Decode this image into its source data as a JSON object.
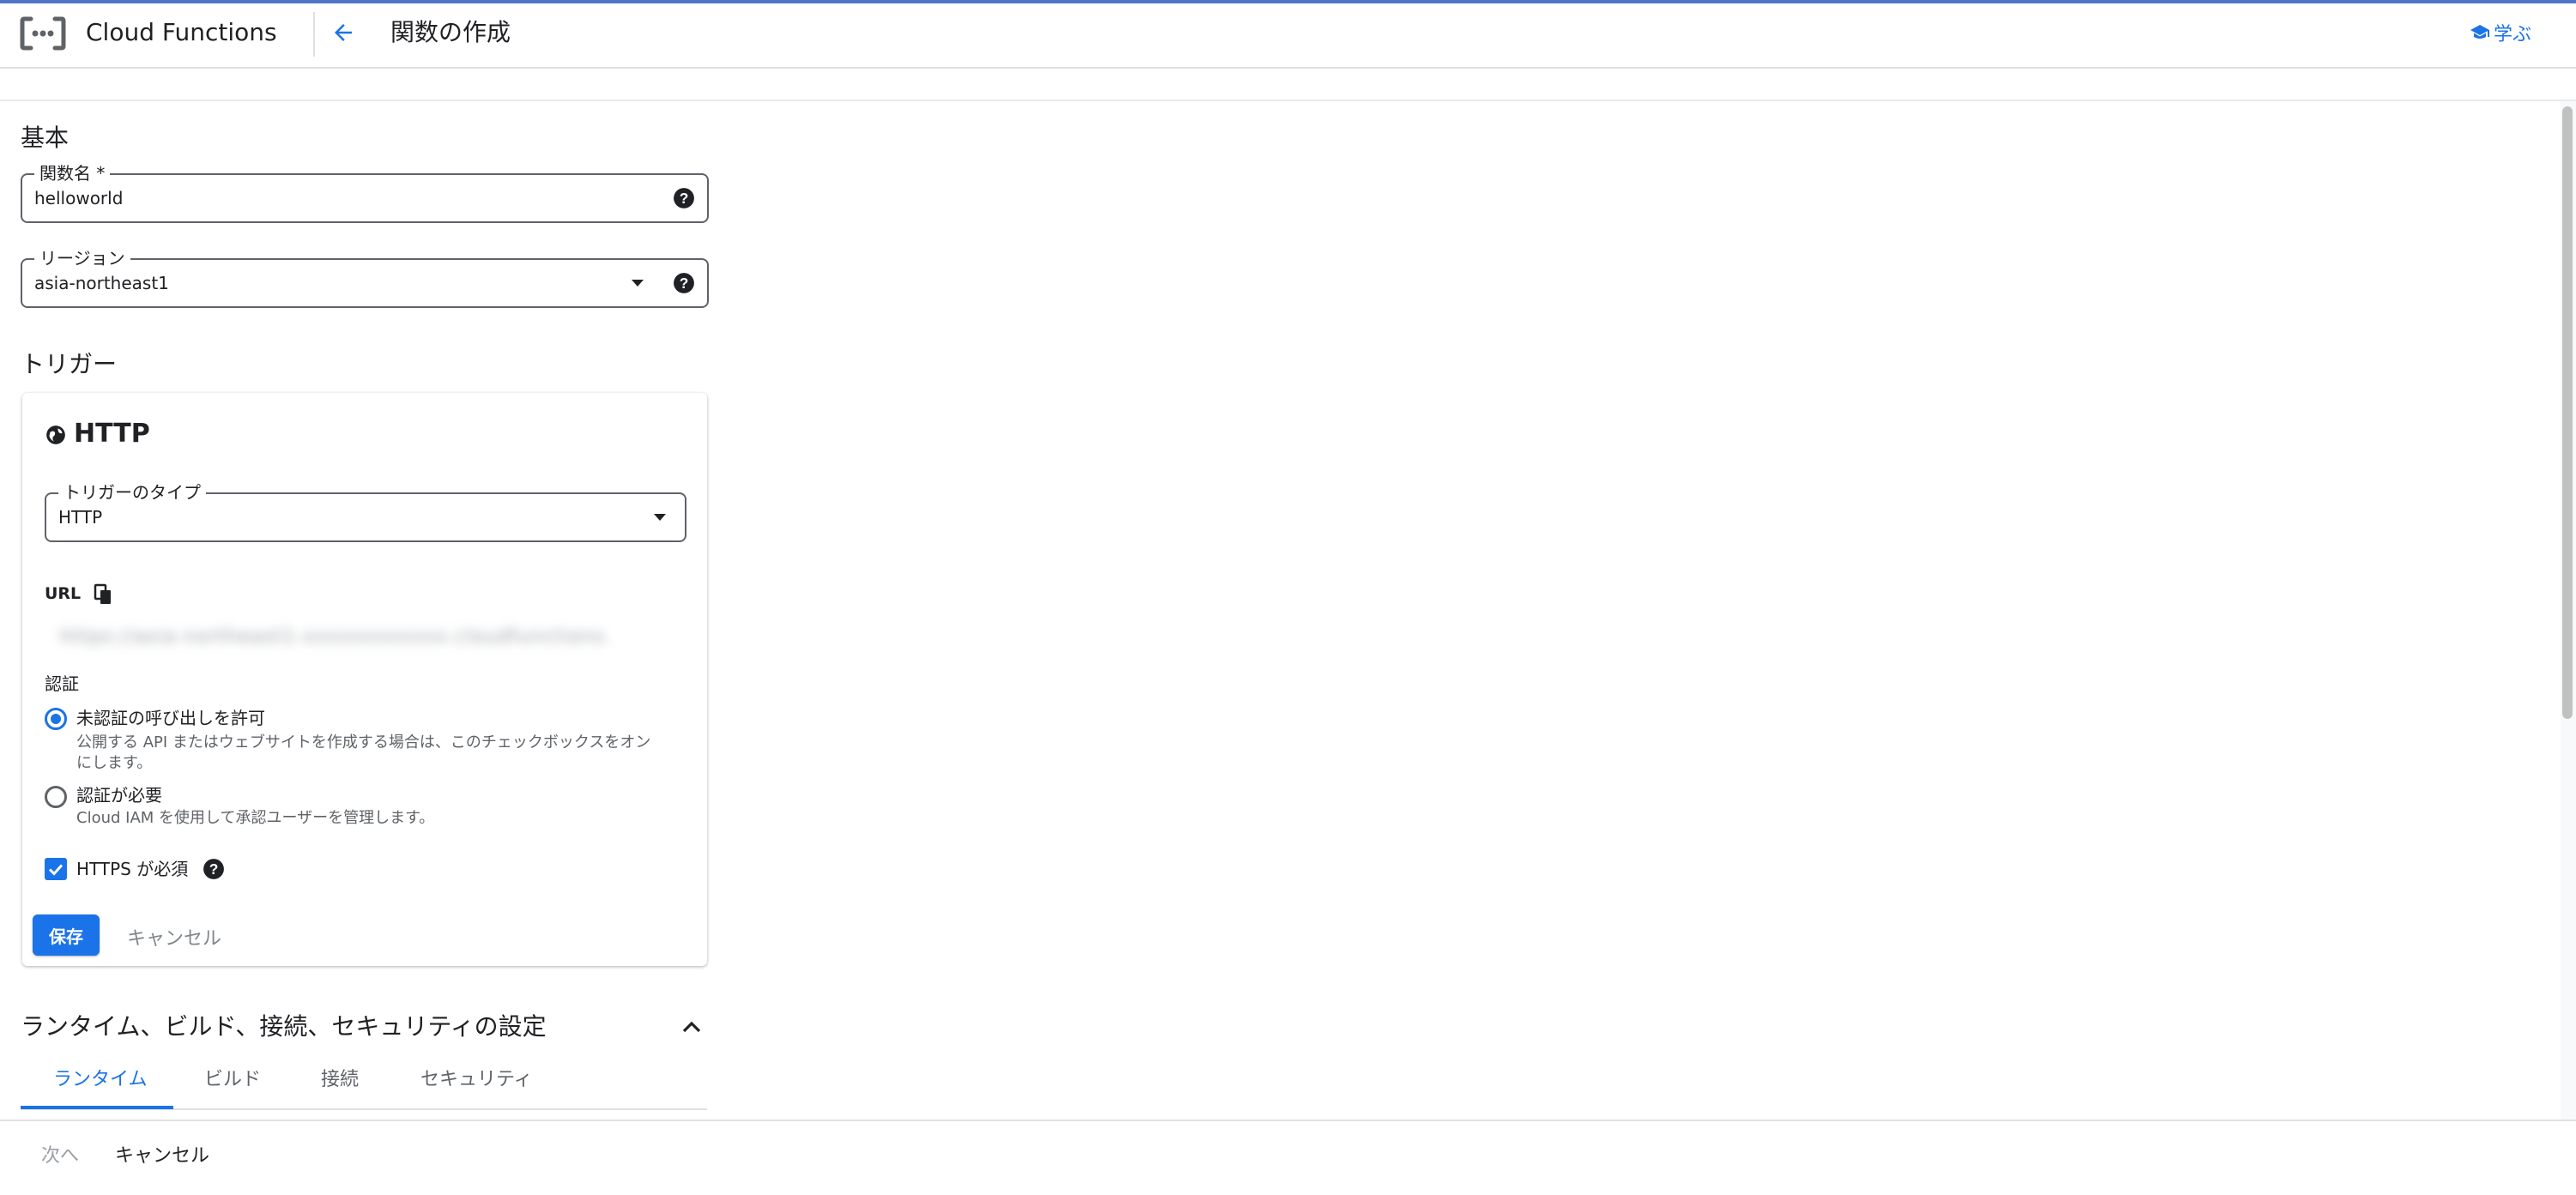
{
  "header": {
    "app_title": "Cloud Functions",
    "page_title": "関数の作成",
    "learn_label": "学ぶ"
  },
  "basic": {
    "heading": "基本",
    "function_name": {
      "label": "関数名 *",
      "value": "helloworld"
    },
    "region": {
      "label": "リージョン",
      "value": "asia-northeast1"
    }
  },
  "trigger": {
    "heading": "トリガー",
    "card_title": "HTTP",
    "type_field": {
      "label": "トリガーのタイプ",
      "value": "HTTP"
    },
    "url_label": "URL",
    "url_value": "https://asia-northeast1-xxxxxxxxxxxx.cloudfunctions.net/helloworld",
    "auth_label": "認証",
    "auth_options": [
      {
        "title": "未認証の呼び出しを許可",
        "desc1": "公開する API またはウェブサイトを作成する場合は、このチェックボックスをオン",
        "desc2": "にします。",
        "selected": true
      },
      {
        "title": "認証が必要",
        "desc1": "Cloud IAM を使用して承認ユーザーを管理します。",
        "selected": false
      }
    ],
    "https_label": "HTTPS が必須",
    "https_checked": true,
    "save_label": "保存",
    "cancel_label": "キャンセル"
  },
  "runtime_section": {
    "heading": "ランタイム、ビルド、接続、セキュリティの設定",
    "tabs": [
      "ランタイム",
      "ビルド",
      "接続",
      "セキュリティ"
    ],
    "active_tab": 0
  },
  "footer": {
    "next_label": "次へ",
    "cancel_label": "キャンセル"
  },
  "colors": {
    "accent": "#1a73e8",
    "header_accent": "#4f75c6"
  }
}
